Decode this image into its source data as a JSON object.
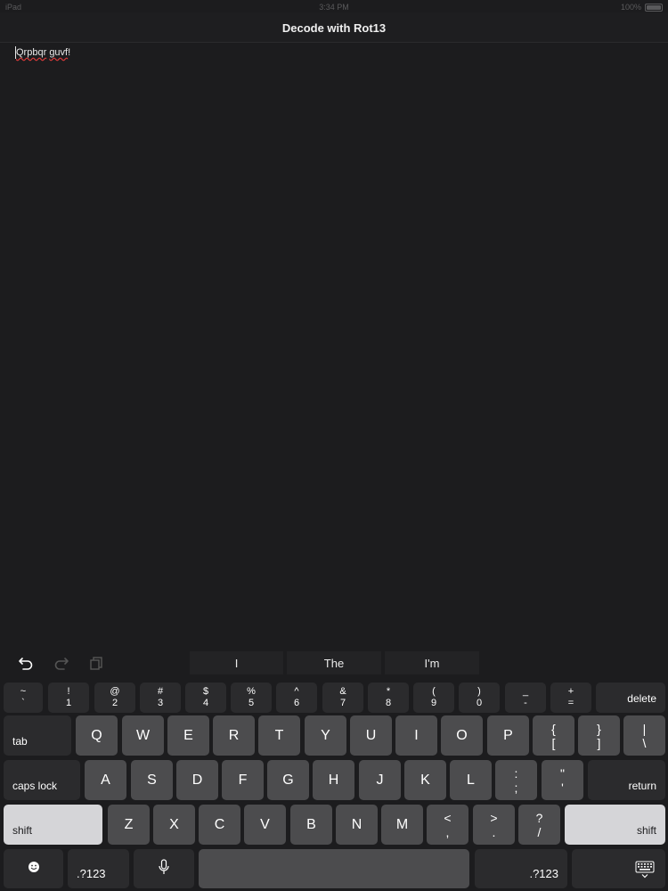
{
  "status_bar": {
    "carrier": "iPad",
    "time": "3:34 PM",
    "battery": "100%"
  },
  "nav": {
    "title": "Decode with Rot13"
  },
  "editor": {
    "word1": "Qrpbqr",
    "space": " ",
    "word2": "guvf",
    "punct": "!"
  },
  "suggestions": [
    "I",
    "The",
    "I'm"
  ],
  "keyboard": {
    "number_row": [
      {
        "top": "~",
        "bottom": "`"
      },
      {
        "top": "!",
        "bottom": "1"
      },
      {
        "top": "@",
        "bottom": "2"
      },
      {
        "top": "#",
        "bottom": "3"
      },
      {
        "top": "$",
        "bottom": "4"
      },
      {
        "top": "%",
        "bottom": "5"
      },
      {
        "top": "^",
        "bottom": "6"
      },
      {
        "top": "&",
        "bottom": "7"
      },
      {
        "top": "*",
        "bottom": "8"
      },
      {
        "top": "(",
        "bottom": "9"
      },
      {
        "top": ")",
        "bottom": "0"
      },
      {
        "top": "_",
        "bottom": "-"
      },
      {
        "top": "+",
        "bottom": "="
      }
    ],
    "delete": "delete",
    "tab": "tab",
    "row_q": [
      "Q",
      "W",
      "E",
      "R",
      "T",
      "Y",
      "U",
      "I",
      "O",
      "P"
    ],
    "row_q_symbols": [
      {
        "top": "{",
        "bottom": "["
      },
      {
        "top": "}",
        "bottom": "]"
      },
      {
        "top": "|",
        "bottom": "\\"
      }
    ],
    "caps_lock": "caps lock",
    "row_a": [
      "A",
      "S",
      "D",
      "F",
      "G",
      "H",
      "J",
      "K",
      "L"
    ],
    "row_a_symbols": [
      {
        "top": ":",
        "bottom": ";"
      },
      {
        "top": "\"",
        "bottom": "'"
      }
    ],
    "return": "return",
    "shift_left": "shift",
    "row_z": [
      "Z",
      "X",
      "C",
      "V",
      "B",
      "N",
      "M"
    ],
    "row_z_symbols": [
      {
        "top": "<",
        "bottom": ","
      },
      {
        "top": ">",
        "bottom": "."
      },
      {
        "top": "?",
        "bottom": "/"
      }
    ],
    "shift_right": "shift",
    "numbers_left": ".?123",
    "numbers_right": ".?123"
  },
  "icons": {
    "undo": "undo-icon",
    "redo": "redo-icon",
    "paste": "paste-icon",
    "emoji": "emoji-icon",
    "dictation": "microphone-icon",
    "dismiss": "keyboard-dismiss-icon"
  }
}
